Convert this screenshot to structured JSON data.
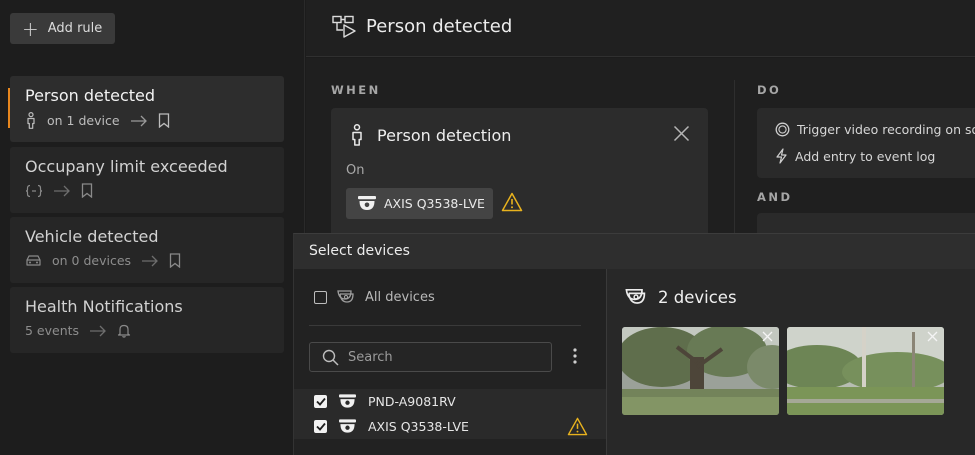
{
  "sidebar": {
    "add_rule_label": "Add rule",
    "rules": [
      {
        "title": "Person detected",
        "sub": "on 1 device",
        "active": true
      },
      {
        "title": "Occupany limit exceeded",
        "sub": "",
        "active": false
      },
      {
        "title": "Vehicle detected",
        "sub": "on 0 devices",
        "active": false
      },
      {
        "title": "Health Notifications",
        "sub": "5 events",
        "active": false
      }
    ]
  },
  "header": {
    "title": "Person detected"
  },
  "when": {
    "label": "WHEN",
    "card_title": "Person detection",
    "on_label": "On",
    "device_chip": "AXIS Q3538-LVE"
  },
  "do": {
    "label": "DO",
    "items": [
      "Trigger video recording on source",
      "Add entry to event log"
    ],
    "and_label": "AND"
  },
  "modal": {
    "title": "Select devices",
    "all_devices_label": "All devices",
    "search_placeholder": "Search",
    "devices": [
      {
        "name": "PND-A9081RV",
        "checked": true,
        "warning": false
      },
      {
        "name": "AXIS Q3538-LVE",
        "checked": true,
        "warning": true
      }
    ],
    "selected_count_label": "2 devices"
  },
  "colors": {
    "accent": "#e8871e",
    "warning": "#e8b21e"
  }
}
